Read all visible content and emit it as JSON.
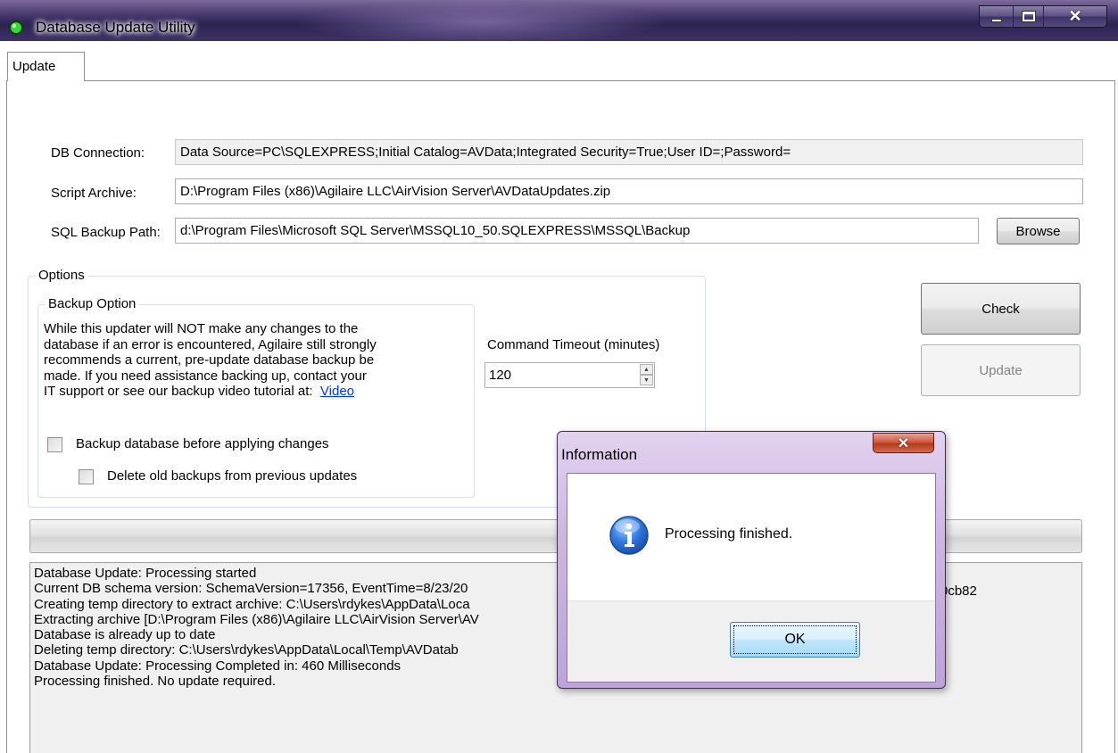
{
  "window": {
    "title": "Database Update Utility"
  },
  "tabs": [
    {
      "label": "Update"
    }
  ],
  "form": {
    "db_connection_label": "DB Connection:",
    "db_connection_value": "Data Source=PC\\SQLEXPRESS;Initial Catalog=AVData;Integrated Security=True;User ID=;Password=",
    "script_archive_label": "Script Archive:",
    "script_archive_value": "D:\\Program Files (x86)\\Agilaire LLC\\AirVision Server\\AVDataUpdates.zip",
    "sql_backup_label": "SQL Backup Path:",
    "sql_backup_value": "d:\\Program Files\\Microsoft SQL Server\\MSSQL10_50.SQLEXPRESS\\MSSQL\\Backup",
    "browse_label": "Browse"
  },
  "options": {
    "legend": "Options",
    "backup_option": {
      "legend": "Backup Option",
      "description_lines": [
        "While this updater will NOT make any changes to the",
        "database if an error is encountered, Agilaire still strongly",
        "recommends a current, pre-update database backup be",
        "made. If you need assistance backing up, contact your"
      ],
      "last_line_prefix": "IT support or see our backup video tutorial at:",
      "video_link": "Video",
      "backup_checkbox_label": "Backup database before applying changes",
      "delete_checkbox_label": "Delete old backups from previous updates"
    },
    "command_timeout_label": "Command Timeout (minutes)",
    "command_timeout_value": "120"
  },
  "actions": {
    "check_label": "Check",
    "update_label": "Update"
  },
  "log": {
    "lines": [
      "Database Update: Processing started",
      "Current DB schema version: SchemaVersion=17356, EventTime=8/23/20",
      "Creating temp directory to extract archive: C:\\Users\\rdykes\\AppData\\Loca",
      "Extracting archive [D:\\Program Files (x86)\\Agilaire LLC\\AirVision Server\\AV",
      "Database is already up to date",
      "Deleting temp directory: C:\\Users\\rdykes\\AppData\\Local\\Temp\\AVDatab",
      "Database Update: Processing Completed in: 460 Milliseconds",
      "Processing finished.  No update required."
    ],
    "trailing_fragment": "0cb82"
  },
  "dialog": {
    "title": "Information",
    "message": "Processing finished.",
    "ok_label": "OK",
    "icon": "info-icon"
  },
  "colors": {
    "titlebar": "#3c2f63",
    "link": "#0033ff",
    "log_background": "#f0f0f0",
    "dialog_frame": "#cdb6e2",
    "info_icon": "#1e62c8"
  }
}
